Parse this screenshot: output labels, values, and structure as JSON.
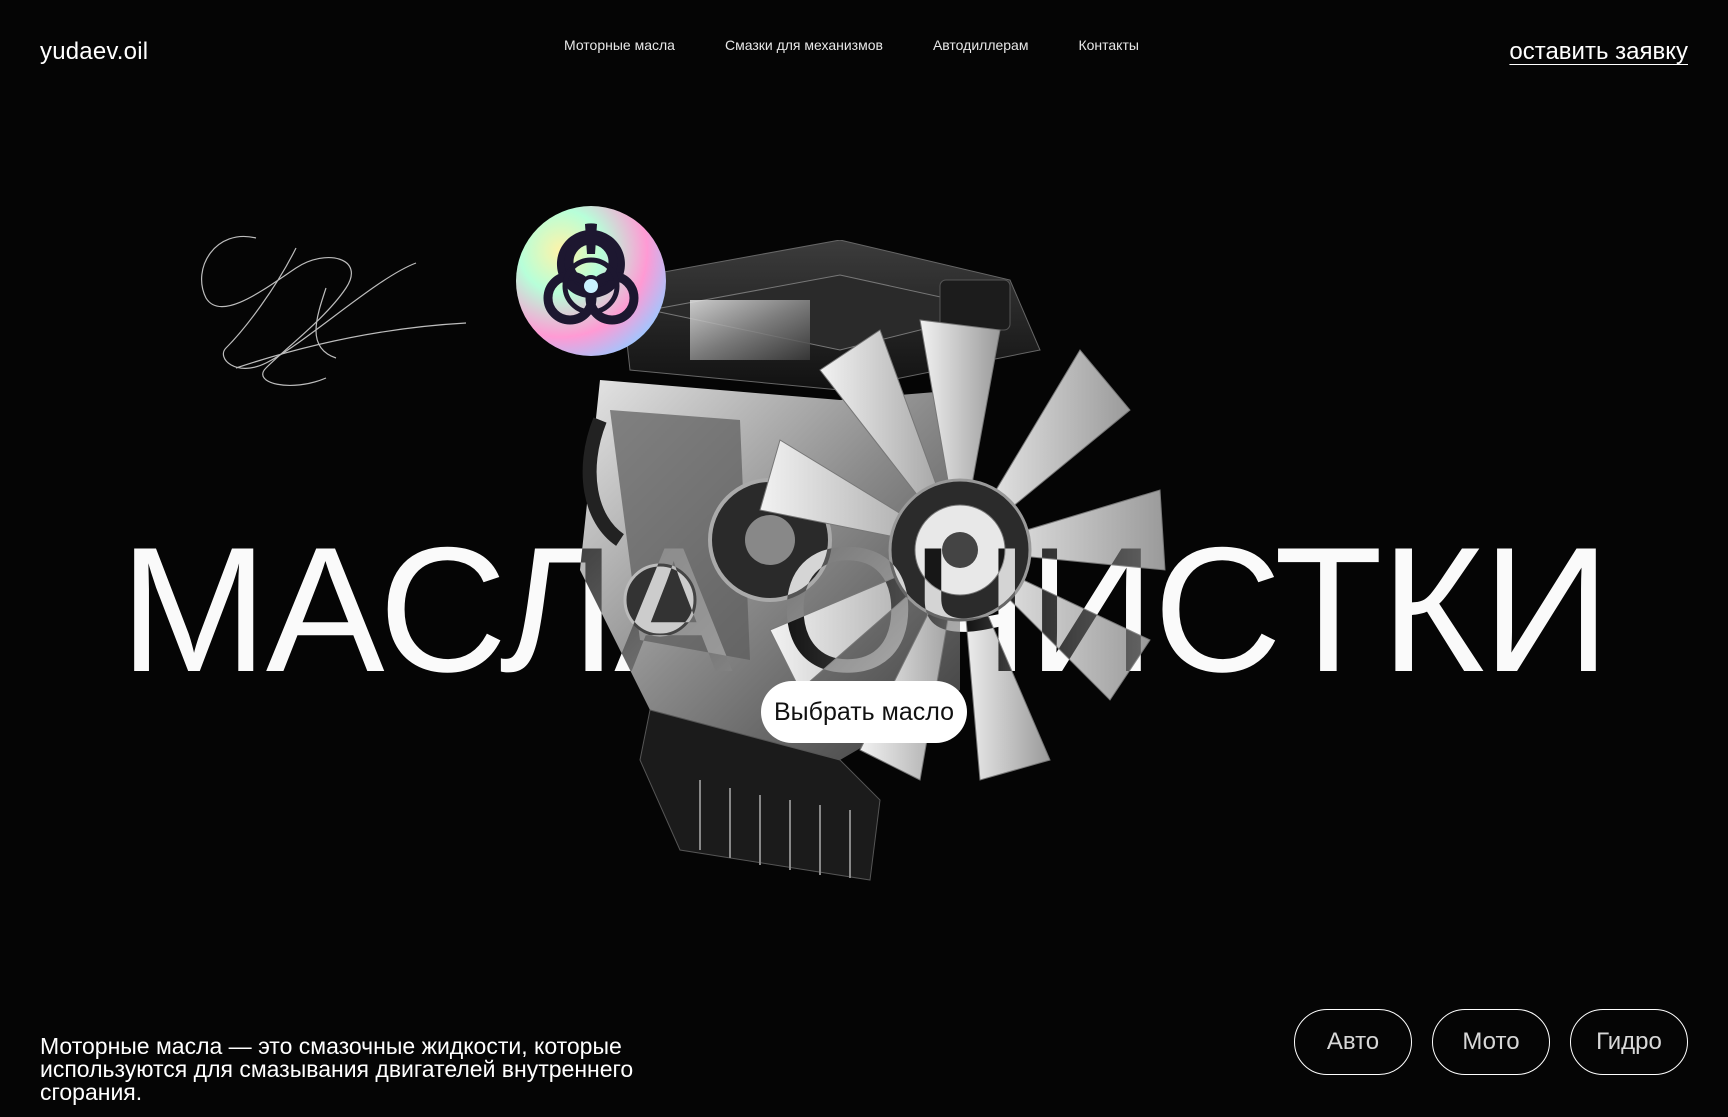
{
  "header": {
    "logo": "yudaev.oil",
    "nav": [
      {
        "label": "Моторные масла"
      },
      {
        "label": "Смазки для механизмов"
      },
      {
        "label": "Автодиллерам"
      },
      {
        "label": "Контакты"
      }
    ],
    "cta_label": "оставить заявку"
  },
  "hero": {
    "headline": "МАСЛА ОЧИСТКИ",
    "button_label": "Выбрать масло"
  },
  "description": "Моторные масла — это смазочные жидкости, которые используются для смазывания двигателей внутреннего сгорания.",
  "categories": [
    {
      "label": "Авто"
    },
    {
      "label": "Мото"
    },
    {
      "label": "Гидро"
    }
  ],
  "colors": {
    "background": "#050505",
    "text": "#ffffff",
    "button": "#ffffff"
  },
  "icons": {
    "hazard": "biohazard-icon",
    "signature": "signature-scribble"
  }
}
